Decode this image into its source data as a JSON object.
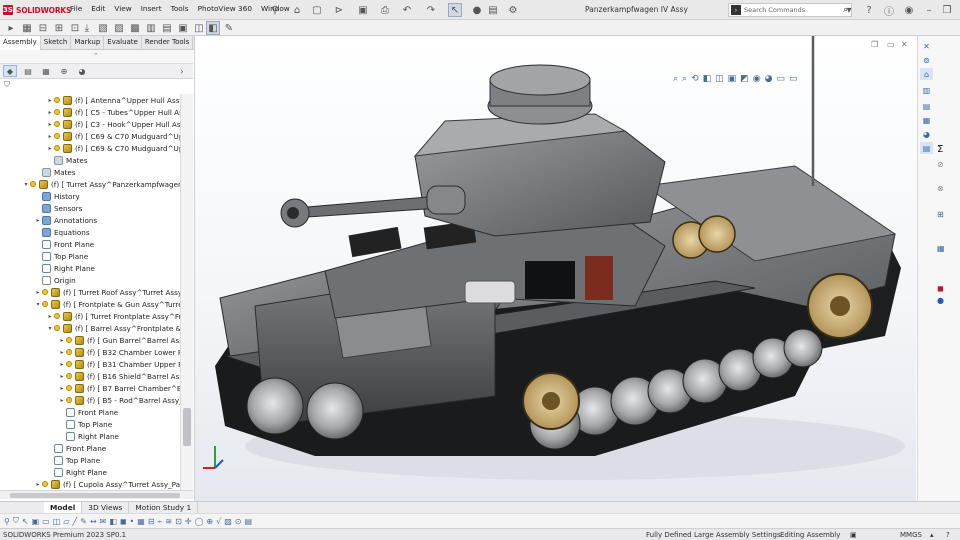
{
  "app": {
    "brand": "SOLIDWORKS",
    "doc_title": "Panzerkampfwagen IV Assy",
    "menu": [
      "File",
      "Edit",
      "View",
      "Insert",
      "Tools",
      "PhotoView 360",
      "Window"
    ],
    "search_placeholder": "Search Commands"
  },
  "command_tabs": [
    "Assembly",
    "Sketch",
    "Markup",
    "Evaluate",
    "Render Tools"
  ],
  "tree": {
    "rows": [
      {
        "label": "(f) [ Antenna^Upper Hull Assy_Main |",
        "indent": 1,
        "expand": "▸",
        "icon": "asm",
        "eye": true
      },
      {
        "label": "(f) [ C5 - Tubes^Upper Hull Assy_Mai",
        "indent": 1,
        "expand": "▸",
        "icon": "asm",
        "eye": true
      },
      {
        "label": "(f) [ C3 - Hook^Upper Hull Assy_Main",
        "indent": 1,
        "expand": "▸",
        "icon": "asm",
        "eye": true
      },
      {
        "label": "(f) [ C69 & C70 Mudguard^Upper Hu",
        "indent": 1,
        "expand": "▸",
        "icon": "asm",
        "eye": true
      },
      {
        "label": "(f) [ C69 & C70 Mudguard^Upper Hu",
        "indent": 1,
        "expand": "▸",
        "icon": "asm",
        "eye": true
      },
      {
        "label": "Mates",
        "indent": 1,
        "expand": "",
        "icon": "mat",
        "eye": false
      },
      {
        "label": "Mates",
        "indent": 0,
        "expand": "",
        "icon": "mat",
        "eye": false
      },
      {
        "label": "(f) [ Turret Assy^Panzerkampfwagen IV A",
        "indent": -1,
        "expand": "▾",
        "icon": "asm",
        "eye": true
      },
      {
        "label": "History",
        "indent": 0,
        "expand": "",
        "icon": "fld",
        "eye": false
      },
      {
        "label": "Sensors",
        "indent": 0,
        "expand": "",
        "icon": "fld",
        "eye": false
      },
      {
        "label": "Annotations",
        "indent": 0,
        "expand": "▸",
        "icon": "fld",
        "eye": false
      },
      {
        "label": "Equations",
        "indent": 0,
        "expand": "",
        "icon": "fld",
        "eye": false
      },
      {
        "label": "Front Plane",
        "indent": 0,
        "expand": "",
        "icon": "pln",
        "eye": false
      },
      {
        "label": "Top Plane",
        "indent": 0,
        "expand": "",
        "icon": "pln",
        "eye": false
      },
      {
        "label": "Right Plane",
        "indent": 0,
        "expand": "",
        "icon": "pln",
        "eye": false
      },
      {
        "label": "Origin",
        "indent": 0,
        "expand": "",
        "icon": "org",
        "eye": false
      },
      {
        "label": "(f) [ Turret Roof Assy^Turret Assy_Panzer",
        "indent": 0,
        "expand": "▸",
        "icon": "asm",
        "eye": true
      },
      {
        "label": "(f) [ Frontplate & Gun Assy^Turret Assy_I",
        "indent": 0,
        "expand": "▾",
        "icon": "asm",
        "eye": true
      },
      {
        "label": "(f) [ Turret Frontplate Assy^Frontplat",
        "indent": 1,
        "expand": "▸",
        "icon": "asm",
        "eye": true
      },
      {
        "label": "(f) [ Barrel Assy^Frontplate & Gun As",
        "indent": 1,
        "expand": "▾",
        "icon": "asm",
        "eye": true
      },
      {
        "label": "(f) [ Gun Barrel^Barrel Assy_Front",
        "indent": 2,
        "expand": "▸",
        "icon": "asm",
        "eye": true
      },
      {
        "label": "(f) [ B32 Chamber Lower Part^Ba",
        "indent": 2,
        "expand": "▸",
        "icon": "asm",
        "eye": true
      },
      {
        "label": "(f) [ B31 Chamber Upper Part^Ba",
        "indent": 2,
        "expand": "▸",
        "icon": "asm",
        "eye": true
      },
      {
        "label": "(f) [ B16 Shield^Barrel Assy_Front",
        "indent": 2,
        "expand": "▸",
        "icon": "asm",
        "eye": true
      },
      {
        "label": "(f) [ B7 Barrel Chamber^Barrel As",
        "indent": 2,
        "expand": "▸",
        "icon": "asm",
        "eye": true
      },
      {
        "label": "(f) [ B5 - Rod^Barrel Assy_Frontpl",
        "indent": 2,
        "expand": "▸",
        "icon": "asm",
        "eye": true
      },
      {
        "label": "Front Plane",
        "indent": 2,
        "expand": "",
        "icon": "pln",
        "eye": false
      },
      {
        "label": "Top Plane",
        "indent": 2,
        "expand": "",
        "icon": "pln",
        "eye": false
      },
      {
        "label": "Right Plane",
        "indent": 2,
        "expand": "",
        "icon": "pln",
        "eye": false
      },
      {
        "label": "Front Plane",
        "indent": 1,
        "expand": "",
        "icon": "pln",
        "eye": false
      },
      {
        "label": "Top Plane",
        "indent": 1,
        "expand": "",
        "icon": "pln",
        "eye": false
      },
      {
        "label": "Right Plane",
        "indent": 1,
        "expand": "",
        "icon": "pln",
        "eye": false
      },
      {
        "label": "(f) [ Cupola Assy^Turret Assy_Panzerkam",
        "indent": 0,
        "expand": "▸",
        "icon": "asm",
        "eye": true
      }
    ]
  },
  "bottom_tabs": [
    "Model",
    "3D Views",
    "Motion Study 1"
  ],
  "status": {
    "version": "SOLIDWORKS Premium 2023 SP0.1",
    "state": "Fully Defined",
    "settings": "Large Assembly Settings",
    "mode": "Editing Assembly",
    "units": "MMGS"
  },
  "colors": {
    "accent": "#c8102e",
    "selection": "#d7e4f3",
    "viewport_top": "#ffffff",
    "viewport_bottom": "#e5e9ef"
  }
}
